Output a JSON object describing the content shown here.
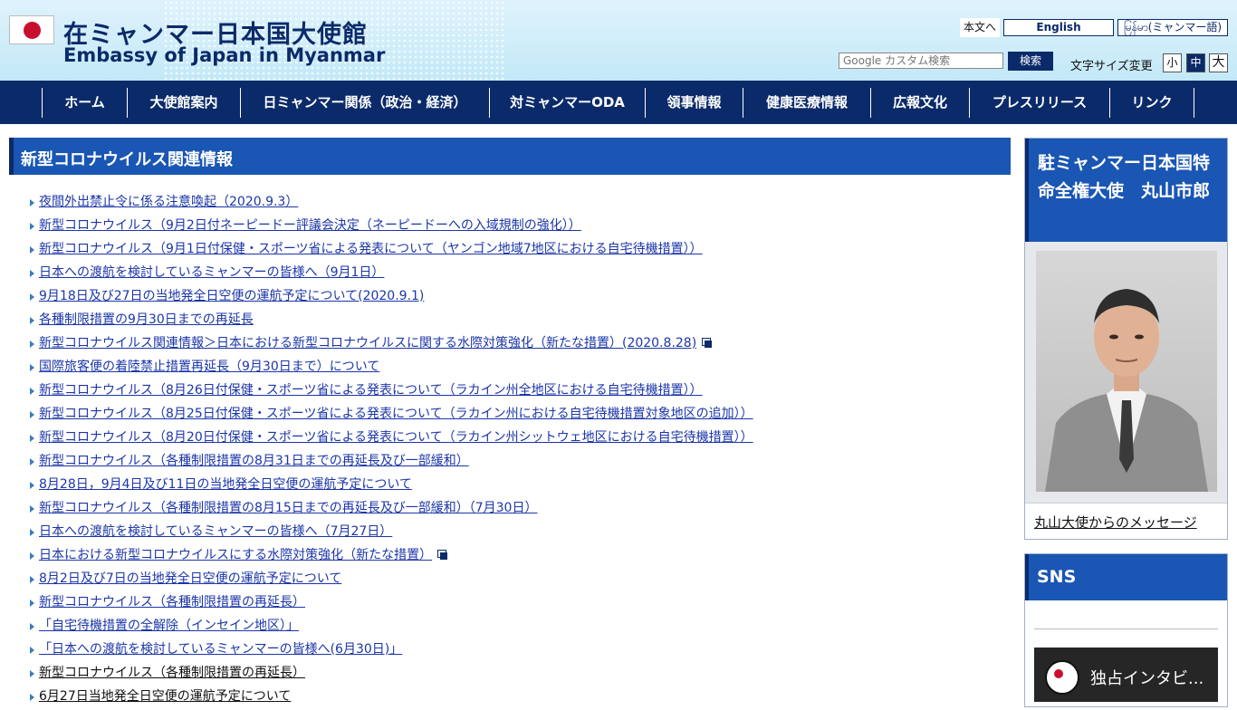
{
  "header": {
    "title_ja": "在ミャンマー日本国大使館",
    "title_en": "Embassy of Japan in Myanmar",
    "skip_link": "本文へ",
    "lang_english": "English",
    "lang_myanmar": "မြန်မာ(ミャンマー語)",
    "search_placeholder": "Google カスタム検索",
    "search_button": "検索",
    "font_size_label": "文字サイズ変更",
    "font_small": "小",
    "font_medium": "中",
    "font_large": "大"
  },
  "nav": {
    "items": [
      {
        "label": "ホーム"
      },
      {
        "label": "大使館案内"
      },
      {
        "label": "日ミャンマー関係（政治・経済）"
      },
      {
        "label": "対ミャンマーODA"
      },
      {
        "label": "領事情報"
      },
      {
        "label": "健康医療情報"
      },
      {
        "label": "広報文化"
      },
      {
        "label": "プレスリリース"
      },
      {
        "label": "リンク"
      }
    ]
  },
  "main": {
    "title": "新型コロナウイルス関連情報",
    "news": [
      {
        "text": "夜間外出禁止令に係る注意喚起（2020.9.3）"
      },
      {
        "text": "新型コロナウイルス（9月2日付ネーピードー評議会決定（ネーピードーへの入域規制の強化））"
      },
      {
        "text": "新型コロナウイルス（9月1日付保健・スポーツ省による発表について（ヤンゴン地域7地区における自宅待機措置））"
      },
      {
        "text": "日本への渡航を検討しているミャンマーの皆様へ（9月1日）"
      },
      {
        "text": "9月18日及び27日の当地発全日空便の運航予定について(2020.9.1)"
      },
      {
        "text": "各種制限措置の9月30日までの再延長"
      },
      {
        "text": "新型コロナウイルス関連情報＞日本における新型コロナウイルスに関する水際対策強化（新たな措置）(2020.8.28)",
        "external": true
      },
      {
        "text": "国際旅客便の着陸禁止措置再延長（9月30日まで）について"
      },
      {
        "text": "新型コロナウイルス（8月26日付保健・スポーツ省による発表について（ラカイン州全地区における自宅待機措置））"
      },
      {
        "text": "新型コロナウイルス（8月25日付保健・スポーツ省による発表について（ラカイン州における自宅待機措置対象地区の追加））"
      },
      {
        "text": "新型コロナウイルス（8月20日付保健・スポーツ省による発表について（ラカイン州シットウェ地区における自宅待機措置））"
      },
      {
        "text": "新型コロナウイルス（各種制限措置の8月31日までの再延長及び一部緩和）"
      },
      {
        "text": "8月28日，9月4日及び11日の当地発全日空便の運航予定について"
      },
      {
        "text": "新型コロナウイルス（各種制限措置の8月15日までの再延長及び一部緩和）（7月30日）"
      },
      {
        "text": "日本への渡航を検討しているミャンマーの皆様へ（7月27日）"
      },
      {
        "text": "日本における新型コロナウイルスにする水際対策強化（新たな措置）",
        "external": true
      },
      {
        "text": "8月2日及び7日の当地発全日空便の運航予定について"
      },
      {
        "text": "新型コロナウイルス（各種制限措置の再延長）"
      },
      {
        "text": "「自宅待機措置の全解除（インセイン地区）」"
      },
      {
        "text": "「日本への渡航を検討しているミャンマーの皆様へ(6月30日)」"
      },
      {
        "text": "新型コロナウイルス（各種制限措置の再延長）",
        "visited": true
      },
      {
        "text": "6月27日当地発全日空便の運航予定について",
        "visited": true
      }
    ]
  },
  "sidebar": {
    "ambassador_title": "駐ミャンマー日本国特命全権大使　丸山市郎",
    "ambassador_link": "丸山大使からのメッセージ",
    "sns_title": "SNS",
    "video_title": "独占インタビ..."
  },
  "colors": {
    "navy": "#0b2a6a",
    "heading_blue": "#1a56b3",
    "link_blue": "#1b36a8"
  }
}
